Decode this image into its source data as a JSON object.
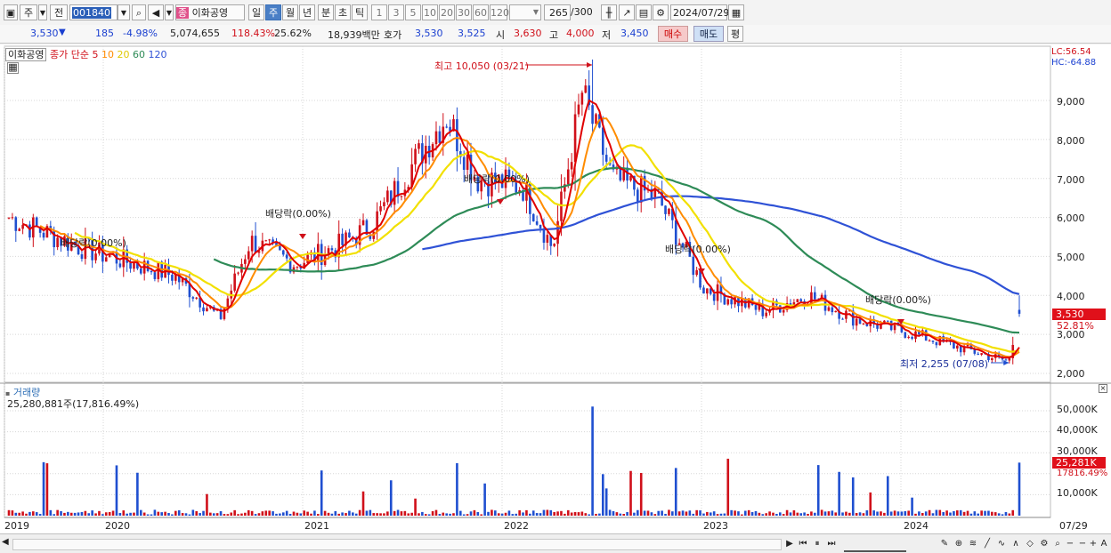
{
  "toolbar": {
    "market": "주",
    "prev": "전",
    "code": "001840",
    "name": "이화공영",
    "name_badge": "종",
    "periods": [
      "일",
      "주",
      "월",
      "년",
      "분",
      "초",
      "틱"
    ],
    "selected_period": "주",
    "intervals": [
      "1",
      "3",
      "5",
      "10",
      "20",
      "30",
      "60",
      "120"
    ],
    "count": "265",
    "count_total": "/300",
    "date": "2024/07/29"
  },
  "info": {
    "price": "3,530",
    "change": "185",
    "change_pct": "-4.98%",
    "volume": "5,074,655",
    "vol_ratio": "118.43%",
    "turnover": "25.62%",
    "amount": "18,939백만",
    "quote_label": "호가",
    "ask": "3,530",
    "bid": "3,525",
    "open_label": "시",
    "open": "3,630",
    "high_label": "고",
    "high": "4,000",
    "low_label": "저",
    "low": "3,450",
    "buy": "매수",
    "sell": "매도",
    "eval": "평"
  },
  "chart_legend": {
    "name": "이화공영",
    "ma_label": "종가 단순",
    "ma_periods": [
      "5",
      "10",
      "20",
      "60",
      "120"
    ]
  },
  "colors": {
    "ma5": "#e00000",
    "ma10": "#ff8c00",
    "ma20": "#f2e000",
    "ma60": "#2e8b57",
    "ma120": "#2f52d6",
    "up": "#d0101a",
    "down": "#1f4fd0"
  },
  "annotations": {
    "lc": "LC:56.54",
    "hc": "HC:-64.88",
    "high": "최고 10,050 (03/21)",
    "low": "최저 2,255 (07/08)",
    "dividend": "배당락(0.00%)",
    "current_price": "3,530",
    "current_pct": "52.81%",
    "vol_title": "거래량",
    "vol_value": "25,280,881주(17,816.49%)",
    "vol_current": "25,281K",
    "vol_pct": "17816.49%"
  },
  "axis": {
    "price_ticks": [
      "9,000",
      "8,000",
      "7,000",
      "6,000",
      "5,000",
      "4,000",
      "3,000",
      "2,000"
    ],
    "vol_ticks": [
      "50,000K",
      "40,000K",
      "30,000K",
      "20,000K",
      "10,000K"
    ],
    "x_labels": [
      "2019",
      "2020",
      "2021",
      "2022",
      "2023",
      "2024"
    ],
    "x_end": "07/29"
  },
  "chart_data": {
    "type": "candlestick",
    "period": "weekly",
    "x_range": [
      "2019-01",
      "2024-07-29"
    ],
    "ylim": [
      2000,
      10000
    ],
    "close_anchors": [
      {
        "date": "2019-01",
        "close": 6000
      },
      {
        "date": "2019-06",
        "close": 5200
      },
      {
        "date": "2019-12",
        "close": 4500
      },
      {
        "date": "2020-03",
        "close": 3400
      },
      {
        "date": "2020-05",
        "close": 5400
      },
      {
        "date": "2020-08",
        "close": 4800
      },
      {
        "date": "2020-11",
        "close": 5300
      },
      {
        "date": "2021-01",
        "close": 5800
      },
      {
        "date": "2021-04",
        "close": 7500
      },
      {
        "date": "2021-06",
        "close": 8600
      },
      {
        "date": "2021-08",
        "close": 7000
      },
      {
        "date": "2021-11",
        "close": 6800
      },
      {
        "date": "2022-01",
        "close": 5200
      },
      {
        "date": "2022-03",
        "close": 9200
      },
      {
        "date": "2022-05",
        "close": 7000
      },
      {
        "date": "2022-08",
        "close": 6500
      },
      {
        "date": "2022-11",
        "close": 4200
      },
      {
        "date": "2023-03",
        "close": 3600
      },
      {
        "date": "2023-06",
        "close": 4000
      },
      {
        "date": "2023-09",
        "close": 3400
      },
      {
        "date": "2024-01",
        "close": 3000
      },
      {
        "date": "2024-07-08",
        "close": 2300
      },
      {
        "date": "2024-07-29",
        "close": 3530
      }
    ],
    "high": {
      "value": 10050,
      "date": "03/21"
    },
    "low": {
      "value": 2255,
      "date": "07/08"
    },
    "last": {
      "open": 3630,
      "high": 4000,
      "low": 3450,
      "close": 3530,
      "volume": 25280881
    }
  }
}
